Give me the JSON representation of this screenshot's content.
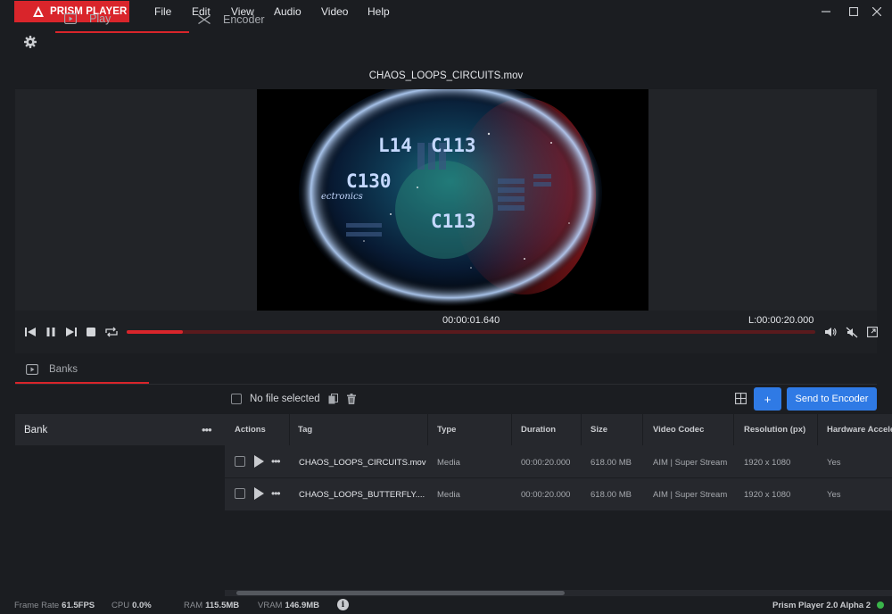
{
  "app": {
    "logo_text": "PRISM PLAYER",
    "menu": [
      "File",
      "Edit",
      "View",
      "Audio",
      "Video",
      "Help"
    ]
  },
  "tabs": {
    "play": "Play",
    "encoder": "Encoder"
  },
  "player": {
    "filename": "CHAOS_LOOPS_CIRCUITS.mov",
    "current_time": "00:00:01.640",
    "length": "L:00:00:20.000",
    "progress": 0.082
  },
  "banks": {
    "tab_label": "Banks",
    "file_label": "No file selected",
    "add_label": "+",
    "send_label": "Send to Encoder",
    "bank_header": "Bank",
    "more": "•••"
  },
  "table": {
    "columns": [
      "Actions",
      "Tag",
      "Type",
      "Duration",
      "Size",
      "Video Codec",
      "Resolution (px)",
      "Hardware Accele"
    ],
    "rows": [
      {
        "tag": "CHAOS_LOOPS_CIRCUITS.mov",
        "type": "Media",
        "duration": "00:00:20.000",
        "size": "618.00 MB",
        "codec": "AIM | Super Stream",
        "resolution": "1920 x 1080",
        "hw": "Yes"
      },
      {
        "tag": "CHAOS_LOOPS_BUTTERFLY....",
        "type": "Media",
        "duration": "00:00:20.000",
        "size": "618.00 MB",
        "codec": "AIM | Super Stream",
        "resolution": "1920 x 1080",
        "hw": "Yes"
      }
    ]
  },
  "status": {
    "frame_rate_label": "Frame Rate",
    "frame_rate": "61.5FPS",
    "cpu_label": "CPU",
    "cpu": "0.0%",
    "ram_label": "RAM",
    "ram": "115.5MB",
    "vram_label": "VRAM",
    "vram": "146.9MB",
    "info": "i",
    "version": "Prism Player 2.0 Alpha 2"
  },
  "colors": {
    "accent_red": "#d9252b",
    "button_blue": "#2f7ae5",
    "status_green": "#3ab54a"
  },
  "video_frame_text": [
    "L14",
    "C113",
    "C130",
    "C113",
    "ectronics"
  ]
}
